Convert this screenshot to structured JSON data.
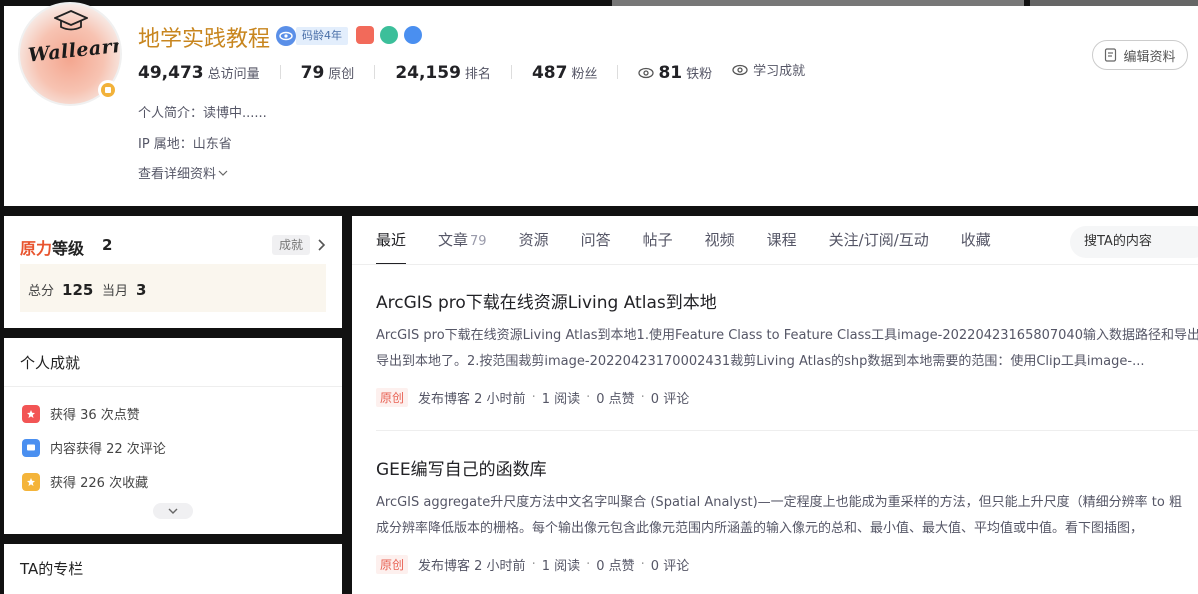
{
  "profile": {
    "name": "地学实践教程",
    "avatar_text": "Wallearn",
    "code_age": "码龄4年",
    "stats": [
      {
        "value": "49,473",
        "label": "总访问量"
      },
      {
        "value": "79",
        "label": "原创"
      },
      {
        "value": "24,159",
        "label": "排名"
      },
      {
        "value": "487",
        "label": "粉丝"
      },
      {
        "value": "81",
        "label": "铁粉"
      }
    ],
    "achievement_link": "学习成就",
    "bio": "个人简介：读博中......",
    "ip": "IP 属地：山东省",
    "details_link": "查看详细资料",
    "edit_button": "编辑资料"
  },
  "level": {
    "title_accent": "原力",
    "title_rest": "等级",
    "level_value": "2",
    "achievement_tag": "成就",
    "total_label": "总分",
    "total_value": "125",
    "month_label": "当月",
    "month_value": "3"
  },
  "achievements": {
    "title": "个人成就",
    "items": [
      {
        "text": "获得 36 次点赞",
        "color": "#f25555"
      },
      {
        "text": "内容获得 22 次评论",
        "color": "#4a8ff0"
      },
      {
        "text": "获得 226 次收藏",
        "color": "#f4b43a"
      }
    ]
  },
  "column": {
    "title": "TA的专栏"
  },
  "tabs": [
    {
      "label": "最近",
      "count": ""
    },
    {
      "label": "文章",
      "count": "79"
    },
    {
      "label": "资源",
      "count": ""
    },
    {
      "label": "问答",
      "count": ""
    },
    {
      "label": "帖子",
      "count": ""
    },
    {
      "label": "视频",
      "count": ""
    },
    {
      "label": "课程",
      "count": ""
    },
    {
      "label": "关注/订阅/互动",
      "count": ""
    },
    {
      "label": "收藏",
      "count": ""
    }
  ],
  "search": {
    "placeholder": "搜TA的内容"
  },
  "articles": [
    {
      "title": "ArcGIS pro下载在线资源Living Atlas到本地",
      "desc_line1": "ArcGIS pro下载在线资源Living Atlas到本地1.使用Feature Class to Feature Class工具image-20220423165807040输入数据路径和导出",
      "desc_line2": "导出到本地了。2.按范围裁剪image-20220423170002431裁剪Living Atlas的shp数据到本地需要的范围：使用Clip工具image-...",
      "tag": "原创",
      "published": "发布博客 2 小时前",
      "reads": "1 阅读",
      "likes": "0 点赞",
      "comments": "0 评论"
    },
    {
      "title": "GEE编写自己的函数库",
      "desc_line1": "ArcGIS aggregate升尺度方法中文名字叫聚合 (Spatial Analyst)—一定程度上也能成为重采样的方法，但只能上升尺度（精细分辨率 to 粗",
      "desc_line2": "成分辨率降低版本的栅格。每个输出像元包含此像元范围内所涵盖的输入像元的总和、最小值、最大值、平均值或中值。看下图插图，",
      "tag": "原创",
      "published": "发布博客 2 小时前",
      "reads": "1 阅读",
      "likes": "0 点赞",
      "comments": "0 评论"
    }
  ],
  "colors": {
    "name": "#c8861f",
    "accent": "#e8542e",
    "tag_red": "#e86254"
  }
}
